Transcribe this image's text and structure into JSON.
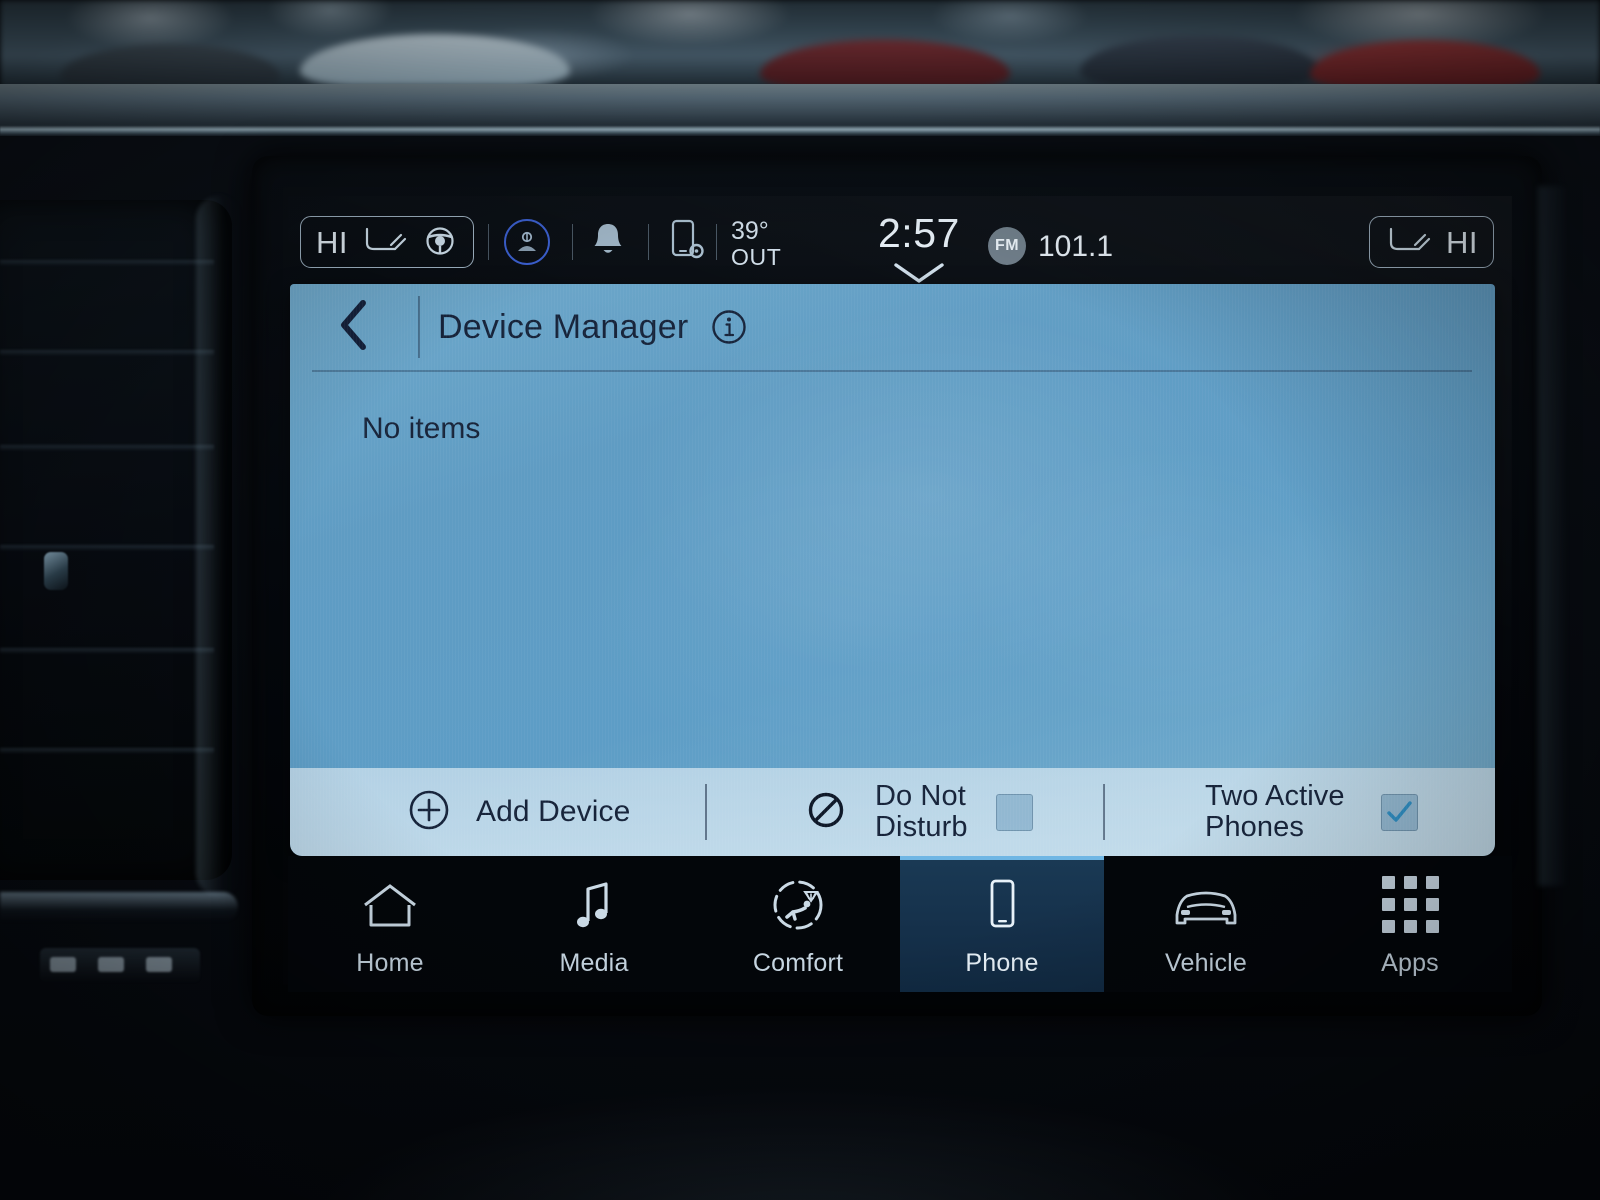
{
  "status_bar": {
    "left_seat_control": {
      "value": "HI",
      "icons": [
        "seat-heat-icon",
        "steering-wheel-heat-icon"
      ]
    },
    "right_seat_control": {
      "value": "HI",
      "icons": [
        "seat-heat-icon"
      ]
    },
    "voice_icon": "voice-assistant-icon",
    "notification_icon": "bell-icon",
    "device_settings_icon": "phone-settings-icon",
    "temperature": "39°",
    "temperature_label": "OUT",
    "clock": "2:57",
    "clock_expand_icon": "chevron-down-icon",
    "radio_band": "FM",
    "radio_frequency": "101.1"
  },
  "panel": {
    "back_icon": "chevron-left-icon",
    "title": "Device Manager",
    "info_icon": "info-icon",
    "empty_message": "No items"
  },
  "footer": {
    "add_device": {
      "label": "Add Device",
      "icon": "plus-circle-icon"
    },
    "do_not_disturb": {
      "label": "Do Not\nDisturb",
      "line1": "Do Not",
      "line2": "Disturb",
      "icon": "do-not-disturb-icon",
      "checked": false
    },
    "two_active_phones": {
      "label": "Two Active\nPhones",
      "line1": "Two Active",
      "line2": "Phones",
      "checked": true
    }
  },
  "nav": {
    "items": [
      {
        "label": "Home",
        "icon": "home-icon",
        "active": false
      },
      {
        "label": "Media",
        "icon": "music-note-icon",
        "active": false
      },
      {
        "label": "Comfort",
        "icon": "comfort-seat-icon",
        "active": false
      },
      {
        "label": "Phone",
        "icon": "phone-icon",
        "active": true
      },
      {
        "label": "Vehicle",
        "icon": "car-icon",
        "active": false
      },
      {
        "label": "Apps",
        "icon": "apps-grid-icon",
        "active": false
      }
    ]
  },
  "colors": {
    "panel_blue": "#5d9dc6",
    "accent_blue": "#6fb6e4",
    "active_tab_bg": "#15304a",
    "text_dark": "#16233a",
    "status_text": "#c3d3df",
    "checkmark": "#2f8fc4"
  }
}
